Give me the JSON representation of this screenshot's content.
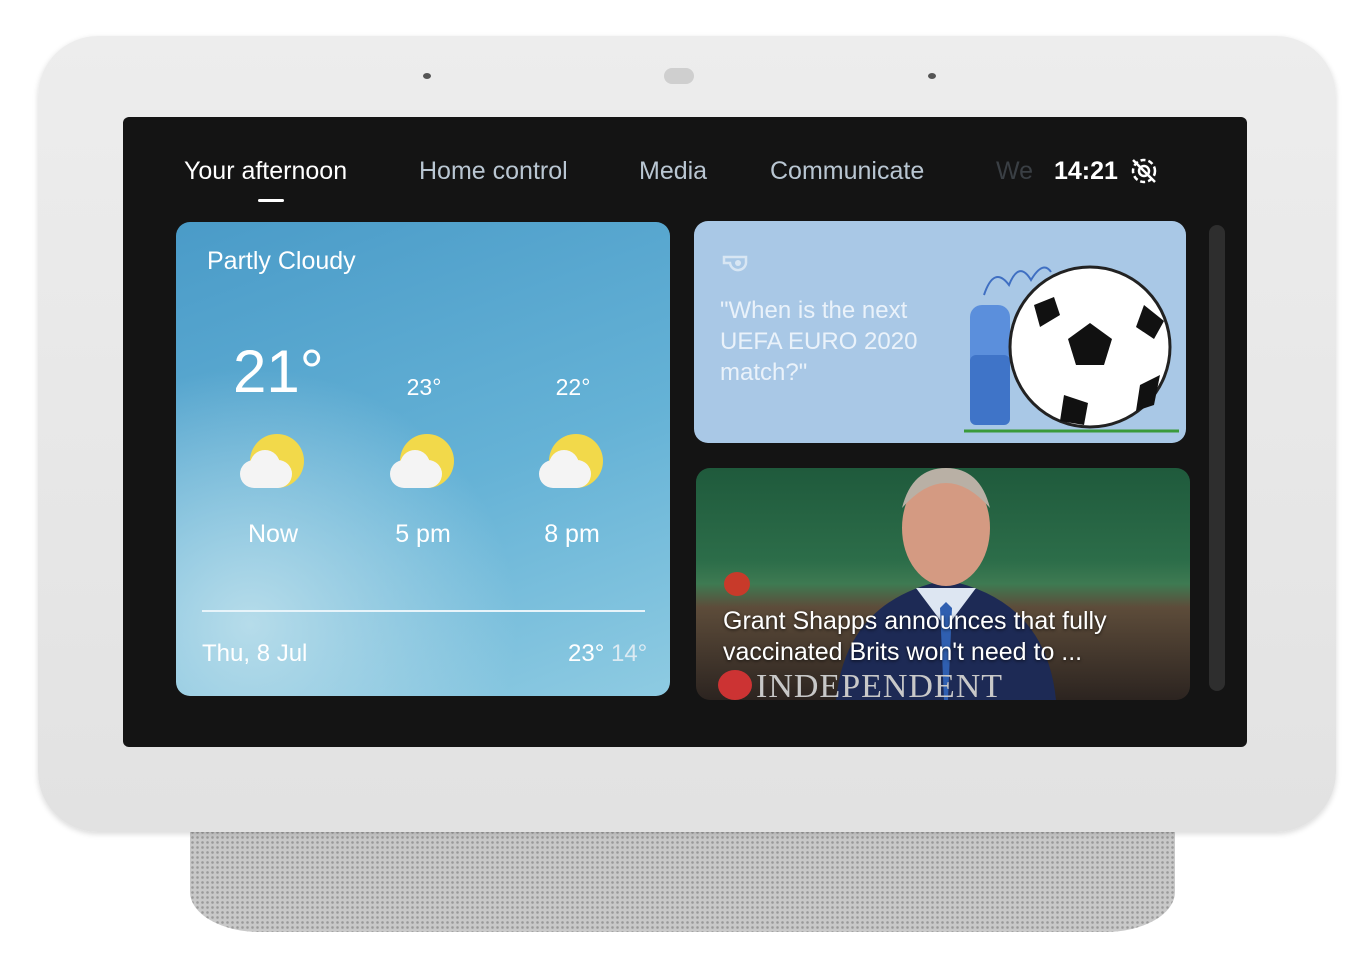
{
  "nav": {
    "tabs": [
      {
        "label": "Your afternoon",
        "active": true
      },
      {
        "label": "Home control"
      },
      {
        "label": "Media"
      },
      {
        "label": "Communicate"
      },
      {
        "label": "We"
      }
    ],
    "time": "14:21",
    "status_icon": "do-not-disturb-off-icon"
  },
  "weather": {
    "condition": "Partly Cloudy",
    "current_temp": "21°",
    "forecast": [
      {
        "label": "Now",
        "icon": "partly-cloudy-icon"
      },
      {
        "label": "5 pm",
        "temp": "23°",
        "icon": "partly-cloudy-icon"
      },
      {
        "label": "8 pm",
        "temp": "22°",
        "icon": "partly-cloudy-icon"
      }
    ],
    "date": "Thu, 8 Jul",
    "high": "23°",
    "low": "14°",
    "colors": {
      "card": "#5aa8d0",
      "sun": "#f2d94a"
    }
  },
  "assistant": {
    "icon": "whistle-icon",
    "suggestion": "\"When is the next UEFA EURO 2020 match?\"",
    "card_color": "#a9c8e6"
  },
  "news": {
    "headline": "Grant Shapps announces that fully vaccinated Brits won't need to ...",
    "source": "INDEPENDENT"
  }
}
